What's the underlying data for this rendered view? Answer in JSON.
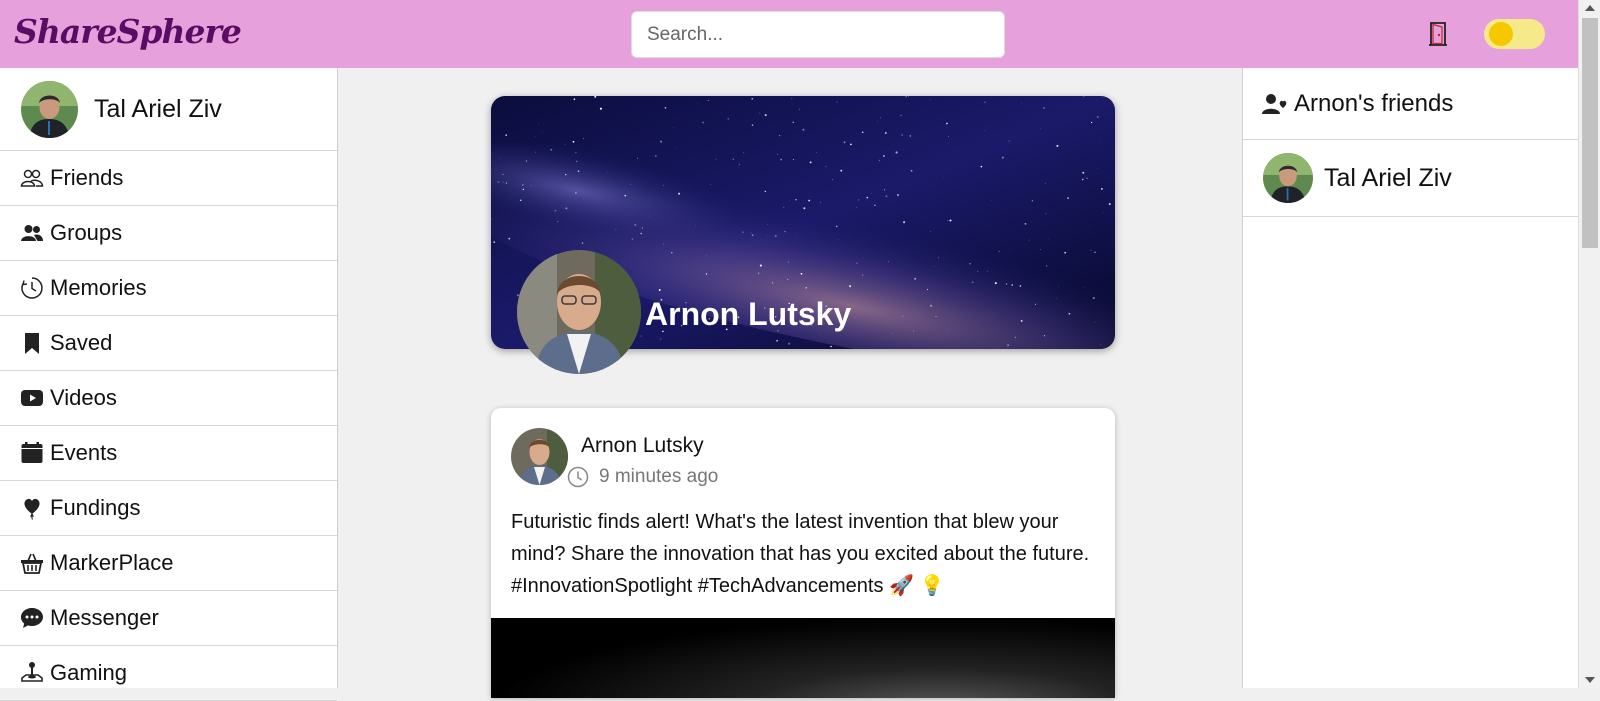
{
  "header": {
    "logo": "ShareSphere",
    "search_placeholder": "Search...",
    "logout_icon": "door-exit-icon",
    "theme_toggle_icon": "toggle-switch"
  },
  "sidebar": {
    "user_name": "Tal Ariel Ziv",
    "items": [
      {
        "label": "Friends",
        "icon": "friends-outline-icon"
      },
      {
        "label": "Groups",
        "icon": "group-icon"
      },
      {
        "label": "Memories",
        "icon": "clock-history-icon"
      },
      {
        "label": "Saved",
        "icon": "bookmark-icon"
      },
      {
        "label": "Videos",
        "icon": "youtube-play-icon"
      },
      {
        "label": "Events",
        "icon": "calendar-icon"
      },
      {
        "label": "Fundings",
        "icon": "balloon-heart-icon"
      },
      {
        "label": "MarkerPlace",
        "icon": "basket-icon"
      },
      {
        "label": "Messenger",
        "icon": "chat-dots-icon"
      },
      {
        "label": "Gaming",
        "icon": "joystick-icon"
      }
    ]
  },
  "profile": {
    "name": "Arnon Lutsky"
  },
  "post": {
    "author": "Arnon Lutsky",
    "time": "9 minutes ago",
    "text": "Futuristic finds alert! What's the latest invention that blew your mind? Share the innovation that has you excited about the future. #InnovationSpotlight #TechAdvancements 🚀 💡"
  },
  "friends_panel": {
    "title": "Arnon's friends",
    "friends": [
      {
        "name": "Tal Ariel Ziv"
      }
    ]
  },
  "colors": {
    "header_bg": "#e6a0dc",
    "logo": "#5a0b63",
    "toggle_track": "#f6e98a",
    "toggle_knob": "#f5c800"
  }
}
